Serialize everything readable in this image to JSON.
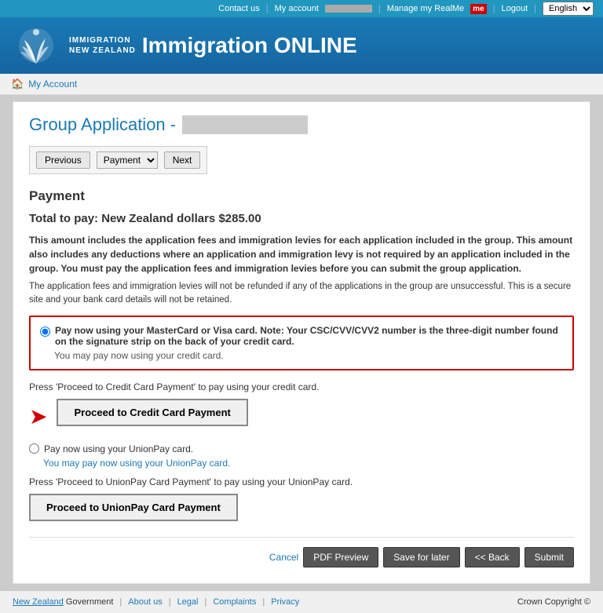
{
  "topnav": {
    "contact": "Contact us",
    "myaccount": "My account",
    "manage": "Manage my RealMe",
    "logout": "Logout",
    "language": "English"
  },
  "header": {
    "logo_line1": "IMMIGRATION",
    "logo_line2": "NEW ZEALAND",
    "title": "Immigration ONLINE"
  },
  "breadcrumb": {
    "home": "🏠",
    "account": "My Account"
  },
  "page": {
    "title_prefix": "Group Application -",
    "section": "Payment",
    "total_label": "Total to pay: New Zealand dollars ",
    "total_amount": "$285.00",
    "info_bold": "This amount includes the application fees and immigration levies for each application included in the group. This amount also includes any deductions where an application and immigration levy is not required by an application included in the group. You must pay the application fees and immigration levies before you can submit the group application.",
    "info_refund": "The application fees and immigration levies will not be refunded if any of the applications in the group are unsuccessful. This is a secure site and your bank card details will not be retained."
  },
  "payment_options": {
    "credit_card": {
      "label": "Pay now using your MasterCard or Visa card. Note: Your CSC/CVV/CVV2 number is the three-digit number found on the signature strip on the back of your credit card.",
      "sub": "You may pay now using your credit card.",
      "instruction": "Press 'Proceed to Credit Card Payment' to pay using your credit card.",
      "button": "Proceed to Credit Card Payment"
    },
    "union_pay": {
      "label": "Pay now using your UnionPay card.",
      "sub": "You may pay now using your UnionPay card.",
      "instruction": "Press 'Proceed to UnionPay Card Payment' to pay using your UnionPay card.",
      "button": "Proceed to UnionPay Card Payment"
    }
  },
  "nav": {
    "previous": "Previous",
    "next": "Next",
    "dropdown_selected": "Payment",
    "dropdown_options": [
      "Payment"
    ]
  },
  "actions": {
    "cancel": "Cancel",
    "pdf_preview": "PDF Preview",
    "save_later": "Save for later",
    "back": "<< Back",
    "submit": "Submit"
  },
  "footer": {
    "nz_govt": "New Zealand",
    "govt_suffix": "Government",
    "about": "About us",
    "legal": "Legal",
    "complaints": "Complaints",
    "privacy": "Privacy",
    "copyright": "Crown Copyright ©"
  }
}
